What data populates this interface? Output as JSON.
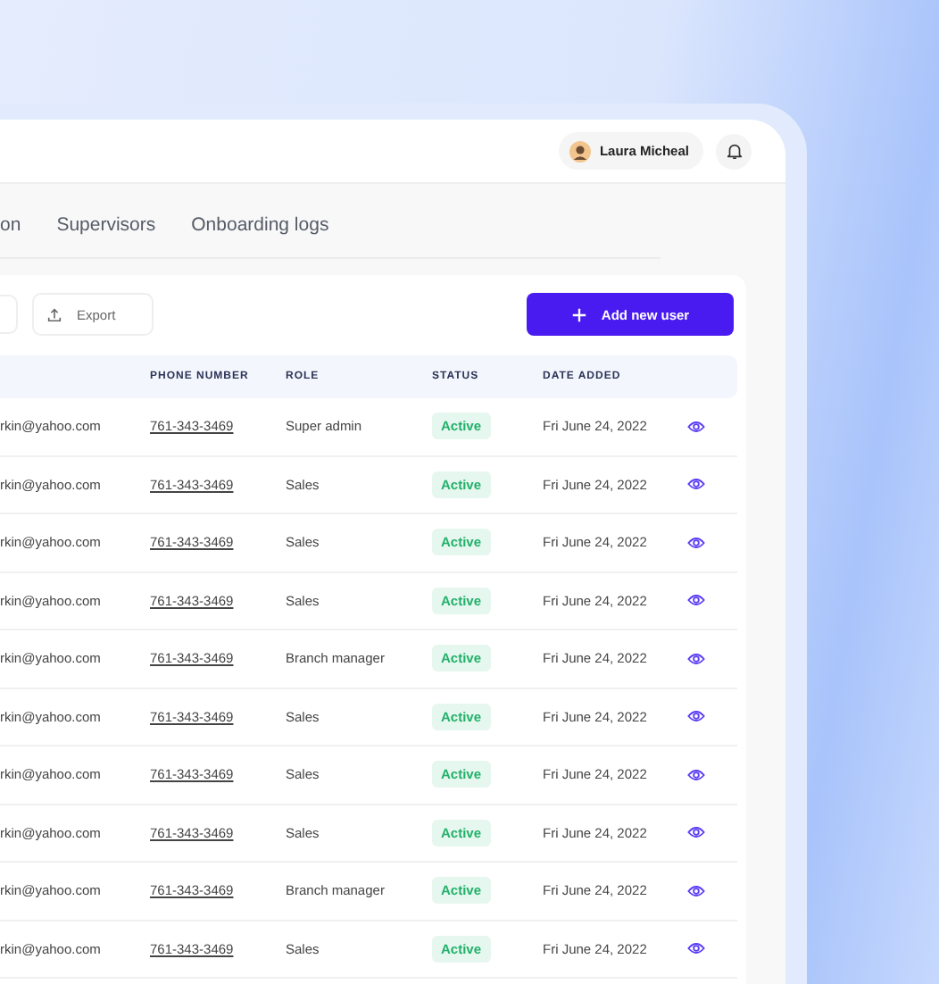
{
  "header": {
    "user_name": "Laura Micheal"
  },
  "tabs": [
    {
      "label": "on",
      "selected": false
    },
    {
      "label": "Supervisors",
      "selected": false
    },
    {
      "label": "Onboarding logs",
      "selected": false
    }
  ],
  "toolbar": {
    "export_label": "Export",
    "add_label": "Add new user"
  },
  "table": {
    "columns": [
      "",
      "PHONE NUMBER",
      "ROLE",
      "STATUS",
      "DATE ADDED"
    ],
    "rows": [
      {
        "email": "rkin@yahoo.com",
        "phone": "761-343-3469",
        "role": "Super admin",
        "status": "Active",
        "date": "Fri June 24, 2022"
      },
      {
        "email": "rkin@yahoo.com",
        "phone": "761-343-3469",
        "role": "Sales",
        "status": "Active",
        "date": "Fri June 24, 2022"
      },
      {
        "email": "rkin@yahoo.com",
        "phone": "761-343-3469",
        "role": "Sales",
        "status": "Active",
        "date": "Fri June 24, 2022"
      },
      {
        "email": "rkin@yahoo.com",
        "phone": "761-343-3469",
        "role": "Sales",
        "status": "Active",
        "date": "Fri June 24, 2022"
      },
      {
        "email": "rkin@yahoo.com",
        "phone": "761-343-3469",
        "role": "Branch manager",
        "status": "Active",
        "date": "Fri June 24, 2022"
      },
      {
        "email": "rkin@yahoo.com",
        "phone": "761-343-3469",
        "role": "Sales",
        "status": "Active",
        "date": "Fri June 24, 2022"
      },
      {
        "email": "rkin@yahoo.com",
        "phone": "761-343-3469",
        "role": "Sales",
        "status": "Active",
        "date": "Fri June 24, 2022"
      },
      {
        "email": "rkin@yahoo.com",
        "phone": "761-343-3469",
        "role": "Sales",
        "status": "Active",
        "date": "Fri June 24, 2022"
      },
      {
        "email": "rkin@yahoo.com",
        "phone": "761-343-3469",
        "role": "Branch manager",
        "status": "Active",
        "date": "Fri June 24, 2022"
      },
      {
        "email": "rkin@yahoo.com",
        "phone": "761-343-3469",
        "role": "Sales",
        "status": "Active",
        "date": "Fri June 24, 2022"
      }
    ]
  }
}
